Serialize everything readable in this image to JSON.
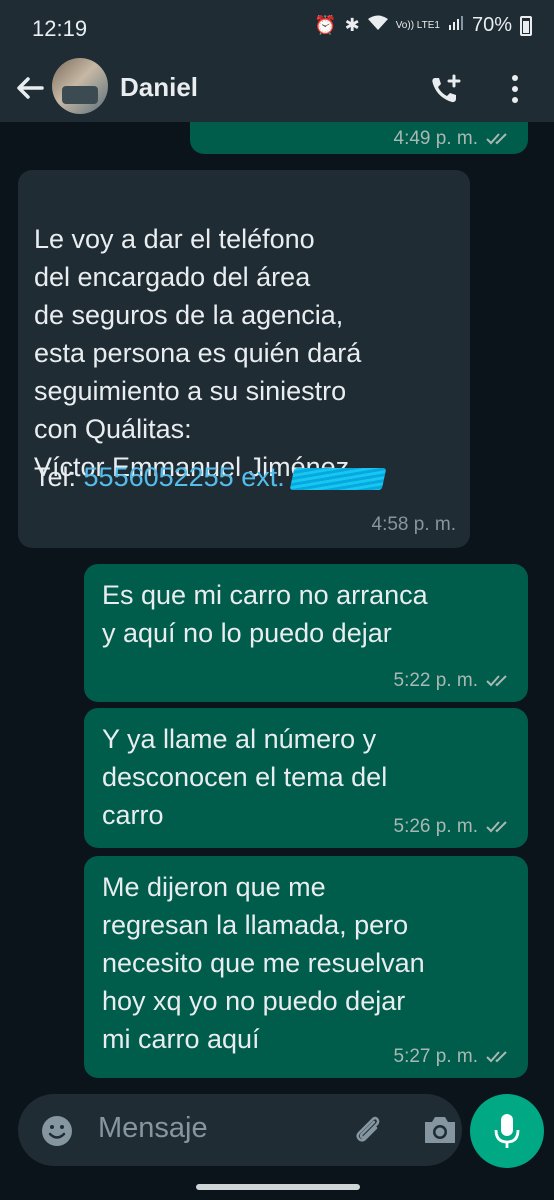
{
  "status": {
    "time": "12:19",
    "network": "Vo)) LTE1",
    "battery": "70%"
  },
  "header": {
    "contact_name": "Daniel"
  },
  "messages": [
    {
      "side": "outgoing",
      "text": "",
      "time": "4:49 p. m."
    },
    {
      "side": "incoming",
      "text": "Le voy a dar el teléfono\ndel encargado del área\nde seguros de la agencia,\nesta persona es quién dará\nseguimiento a su siniestro\ncon Quálitas:\nVíctor Emmanuel Jiménez",
      "tel_label": "Tel: ",
      "phone": "5556052255 ext.",
      "time": "4:58 p. m."
    },
    {
      "side": "outgoing",
      "text": "Es que mi carro no arranca\ny aquí no lo puedo dejar",
      "time": "5:22 p. m."
    },
    {
      "side": "outgoing",
      "text": "Y ya llame al número y\ndesconocen el tema del\ncarro",
      "time": "5:26 p. m."
    },
    {
      "side": "outgoing",
      "text": "Me dijeron que me\nregresan la llamada, pero\nnecesito que me resuelvan\nhoy xq yo no puedo dejar\nmi carro aquí",
      "time": "5:27 p. m."
    }
  ],
  "input": {
    "placeholder": "Mensaje"
  },
  "colors": {
    "incoming": "#1f2c34",
    "outgoing": "#005c4b",
    "accent": "#00a884",
    "link": "#53bdeb"
  }
}
